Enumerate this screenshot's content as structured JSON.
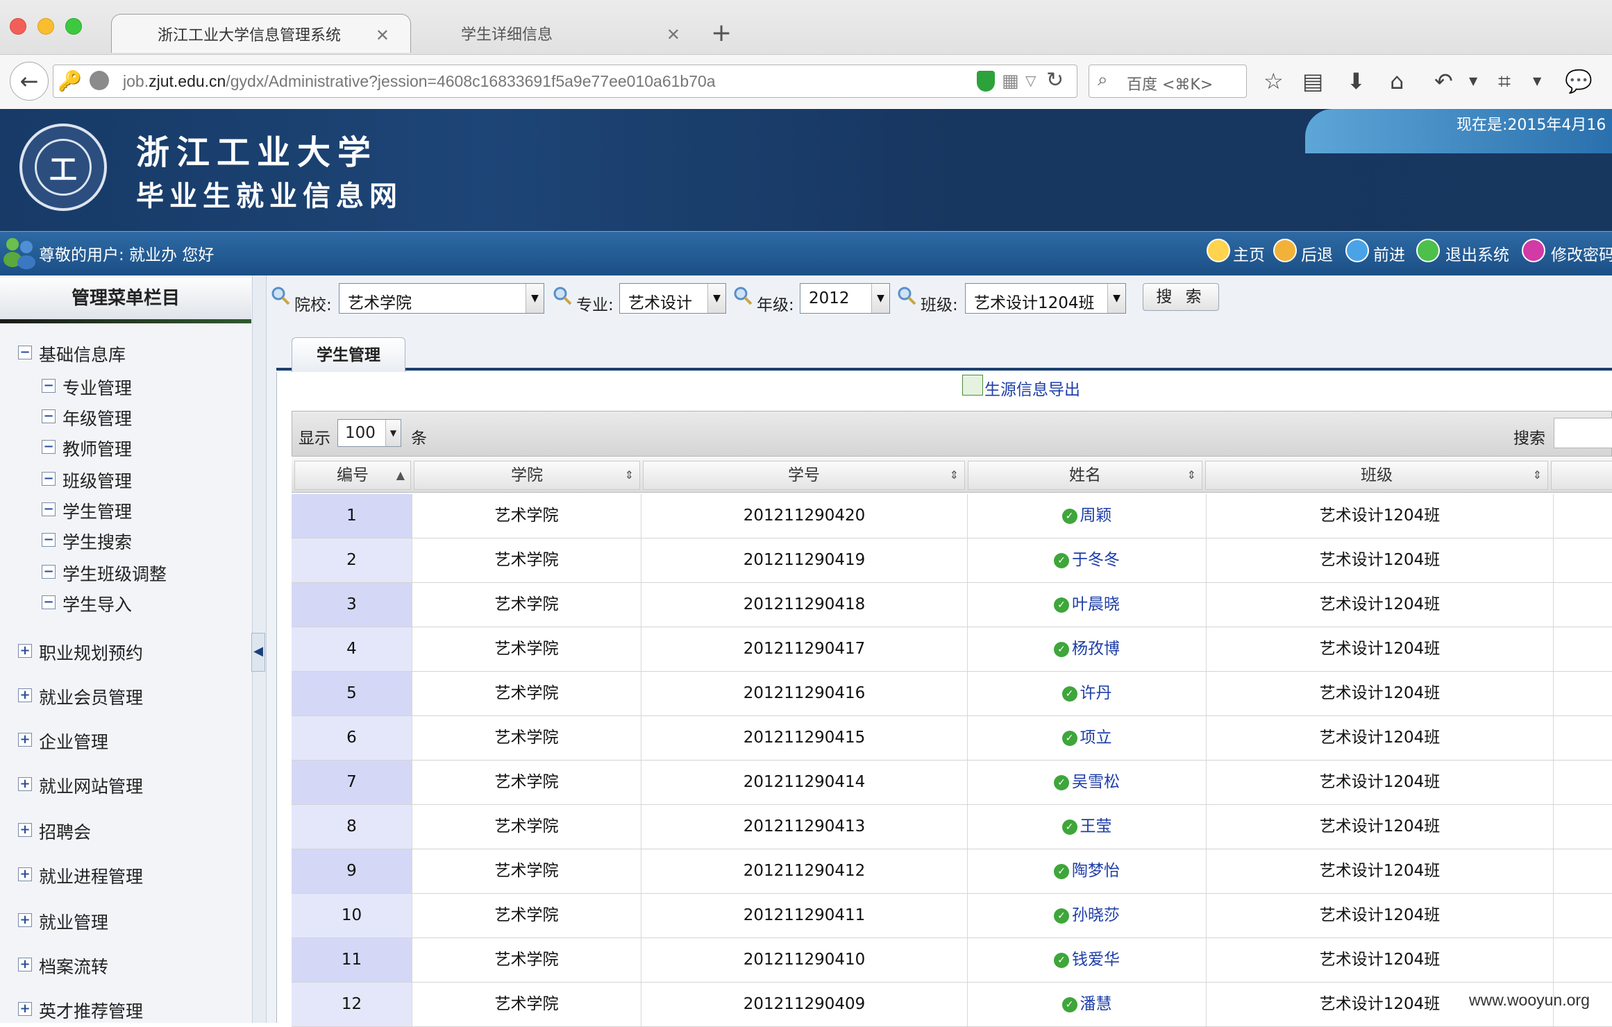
{
  "browser": {
    "tabs": [
      {
        "label": "浙江工业大学信息管理系统"
      },
      {
        "label": "学生详细信息"
      }
    ],
    "url_prefix": "job.",
    "url_domain": "zjut.edu.cn",
    "url_path": "/gydx/Administrative?jession=4608c16833691f5a9e77ee010a61b70a",
    "search_placeholder": "百度 <⌘K>"
  },
  "header": {
    "university": "浙江工业大学",
    "subtitle": "毕业生就业信息网",
    "date": "现在是:2015年4月16",
    "greeting": "尊敬的用户: 就业办 您好",
    "nav": [
      {
        "label": "主页"
      },
      {
        "label": "后退"
      },
      {
        "label": "前进"
      },
      {
        "label": "退出系统"
      },
      {
        "label": "修改密码"
      }
    ]
  },
  "sidebar": {
    "title": "管理菜单栏目",
    "groups": [
      {
        "label": "基础信息库",
        "expanded": true,
        "items": [
          "专业管理",
          "年级管理",
          "教师管理",
          "班级管理",
          "学生管理",
          "学生搜索",
          "学生班级调整",
          "学生导入"
        ]
      },
      {
        "label": "职业规划预约"
      },
      {
        "label": "就业会员管理"
      },
      {
        "label": "企业管理"
      },
      {
        "label": "就业网站管理"
      },
      {
        "label": "招聘会"
      },
      {
        "label": "就业进程管理"
      },
      {
        "label": "就业管理"
      },
      {
        "label": "档案流转"
      },
      {
        "label": "英才推荐管理"
      }
    ]
  },
  "filters": {
    "college_label": "院校:",
    "college_value": "艺术学院",
    "major_label": "专业:",
    "major_value": "艺术设计",
    "grade_label": "年级:",
    "grade_value": "2012",
    "class_label": "班级:",
    "class_value": "艺术设计1204班",
    "search_button": "搜 索"
  },
  "main": {
    "tab_label": "学生管理",
    "export_label": "生源信息导出",
    "show_label": "显示",
    "show_value": "100",
    "show_suffix": "条",
    "search_label": "搜索",
    "columns": [
      "编号",
      "学院",
      "学号",
      "姓名",
      "班级"
    ],
    "rows": [
      {
        "no": "1",
        "college": "艺术学院",
        "id": "201211290420",
        "name": "周颖",
        "class": "艺术设计1204班"
      },
      {
        "no": "2",
        "college": "艺术学院",
        "id": "201211290419",
        "name": "于冬冬",
        "class": "艺术设计1204班"
      },
      {
        "no": "3",
        "college": "艺术学院",
        "id": "201211290418",
        "name": "叶晨晓",
        "class": "艺术设计1204班"
      },
      {
        "no": "4",
        "college": "艺术学院",
        "id": "201211290417",
        "name": "杨孜博",
        "class": "艺术设计1204班"
      },
      {
        "no": "5",
        "college": "艺术学院",
        "id": "201211290416",
        "name": "许丹",
        "class": "艺术设计1204班"
      },
      {
        "no": "6",
        "college": "艺术学院",
        "id": "201211290415",
        "name": "项立",
        "class": "艺术设计1204班"
      },
      {
        "no": "7",
        "college": "艺术学院",
        "id": "201211290414",
        "name": "吴雪松",
        "class": "艺术设计1204班"
      },
      {
        "no": "8",
        "college": "艺术学院",
        "id": "201211290413",
        "name": "王莹",
        "class": "艺术设计1204班"
      },
      {
        "no": "9",
        "college": "艺术学院",
        "id": "201211290412",
        "name": "陶梦怡",
        "class": "艺术设计1204班"
      },
      {
        "no": "10",
        "college": "艺术学院",
        "id": "201211290411",
        "name": "孙晓莎",
        "class": "艺术设计1204班"
      },
      {
        "no": "11",
        "college": "艺术学院",
        "id": "201211290410",
        "name": "钱爱华",
        "class": "艺术设计1204班"
      },
      {
        "no": "12",
        "college": "艺术学院",
        "id": "201211290409",
        "name": "潘慧",
        "class": "艺术设计1204班"
      }
    ]
  },
  "watermark": "www.wooyun.org",
  "colors": {
    "banner": "#173a67",
    "userbar": "#1b4f86",
    "link": "#1e3ea8",
    "status_ok": "#3ea63a",
    "index_cell_odd": "#d4d8f6",
    "index_cell_even": "#e4e7fa"
  }
}
